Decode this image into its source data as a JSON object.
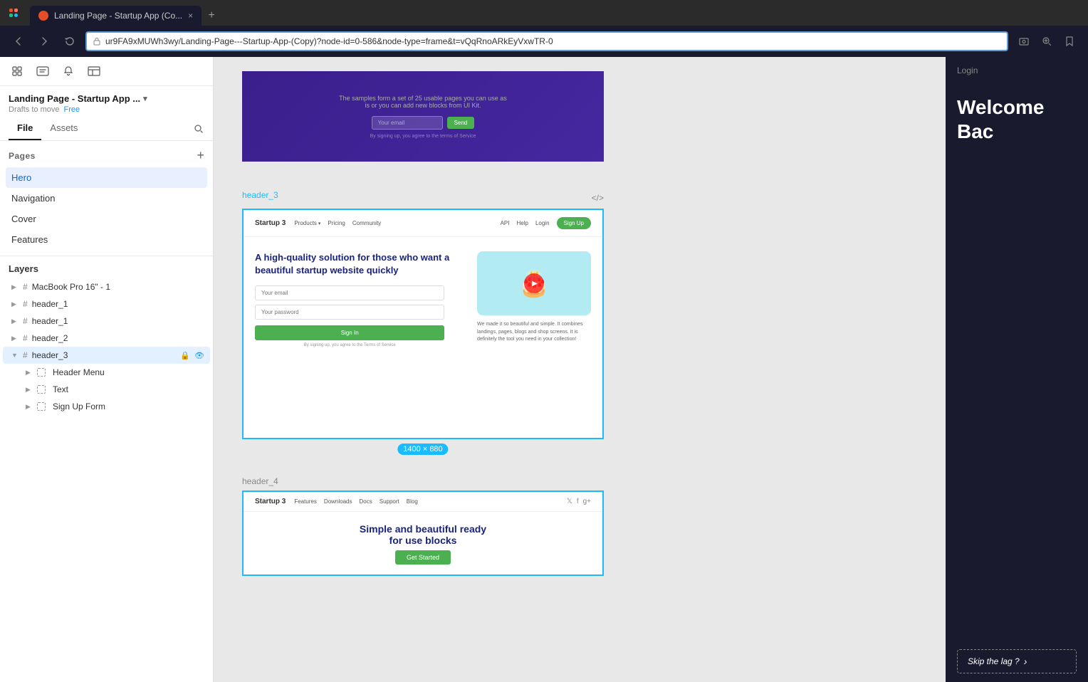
{
  "browser": {
    "tab_title": "Landing Page - Startup App (Co...",
    "tab_close": "×",
    "tab_new": "+",
    "back_btn": "←",
    "forward_btn": "→",
    "refresh_btn": "↻",
    "address": "ur9FA9xMUWh3wy/Landing-Page---Startup-App-(Copy)?node-id=0-586&node-type=frame&t=vQqRnoARkEyVxwTR-0",
    "screenshot_btn": "⊙",
    "zoom_btn": "⊕",
    "bookmark_btn": "☆"
  },
  "sidebar": {
    "tools": [
      "⊞",
      "Aa",
      "🔔",
      "⬜"
    ],
    "file_name": "Landing Page - Startup App ...",
    "file_meta_drafts": "Drafts to move",
    "file_meta_plan": "Free",
    "tab_file": "File",
    "tab_assets": "Assets",
    "search_icon": "🔍",
    "pages_section": "Pages",
    "pages_add": "+",
    "pages": [
      {
        "name": "Hero",
        "active": true
      },
      {
        "name": "Navigation",
        "active": false
      },
      {
        "name": "Cover",
        "active": false
      },
      {
        "name": "Features",
        "active": false
      }
    ],
    "layers_section": "Layers",
    "layers": [
      {
        "name": "MacBook Pro 16\" - 1",
        "level": 0,
        "icon": "hash",
        "expanded": false
      },
      {
        "name": "header_1",
        "level": 0,
        "icon": "hash",
        "expanded": false
      },
      {
        "name": "header_1",
        "level": 0,
        "icon": "hash",
        "expanded": false
      },
      {
        "name": "header_2",
        "level": 0,
        "icon": "hash",
        "expanded": false
      },
      {
        "name": "header_3",
        "level": 0,
        "icon": "hash",
        "expanded": true,
        "selected": true
      },
      {
        "name": "Header Menu",
        "level": 1,
        "icon": "dashed",
        "expanded": false
      },
      {
        "name": "Text",
        "level": 1,
        "icon": "dashed",
        "expanded": false
      },
      {
        "name": "Sign Up Form",
        "level": 1,
        "icon": "dashed",
        "expanded": false
      }
    ]
  },
  "canvas": {
    "frame1": {
      "label": "",
      "hero_text": "The samples form a set of 25 usable pages you can use as\nis or you can add new blocks from UI Kit.",
      "input_placeholder": "Your email",
      "send_btn": "Send",
      "disclaimer": "By signing up, you agree to the terms of Service"
    },
    "frame2": {
      "label": "header_3",
      "code_btn": "</>",
      "size_badge": "1400 × 880",
      "nav_logo": "Startup 3",
      "nav_items": [
        "Products",
        "Pricing",
        "Community"
      ],
      "nav_right": [
        "API",
        "Help",
        "Login"
      ],
      "signup_btn": "Sign Up",
      "title": "A high-quality solution for those who want a beautiful startup website quickly",
      "email_placeholder": "Your email",
      "pw_placeholder": "Your password",
      "signin_btn": "Sign In",
      "disclaimer": "By signing up, you agree to the Terms of Service",
      "desc": "We made it so beautiful and simple. It combines landings, pages, blogs and shop screens. It is definitely the tool you need in your collection!"
    },
    "frame3": {
      "label": "header_4",
      "nav_logo": "Startup 3",
      "nav_items": [
        "Features",
        "Downloads",
        "Docs",
        "Support",
        "Blog"
      ],
      "title": "Simple and beautiful ready",
      "subtitle": "for use blocks"
    }
  },
  "right_panel": {
    "login_label": "Login",
    "welcome_text": "Welcome Bac",
    "skip_btn": "Skip the lag ?",
    "skip_arrow": "›"
  }
}
